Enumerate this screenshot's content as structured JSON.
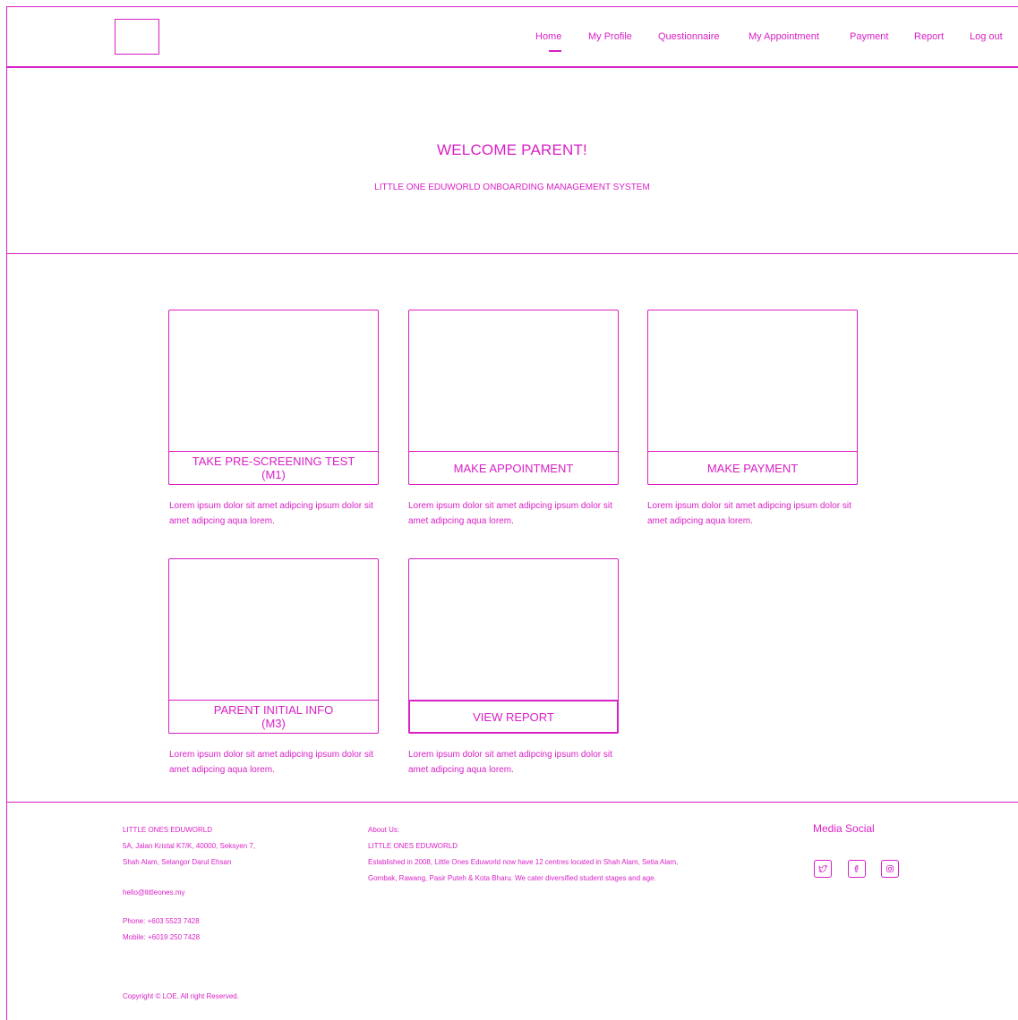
{
  "nav": {
    "items": [
      "Home",
      "My Profile",
      "Questionnaire",
      "My Appointment",
      "Payment",
      "Report",
      "Log out"
    ],
    "active": "Home"
  },
  "hero": {
    "title": "WELCOME PARENT!",
    "subtitle": "LITTLE ONE EDUWORLD ONBOARDING MANAGEMENT SYSTEM"
  },
  "cards": [
    {
      "label": "TAKE PRE-SCREENING TEST\n(M1)",
      "description": "Lorem ipsum dolor sit amet adipcing ipsum dolor sit amet adipcing aqua lorem."
    },
    {
      "label": "MAKE APPOINTMENT",
      "description": "Lorem ipsum dolor sit amet adipcing ipsum dolor sit amet adipcing aqua lorem."
    },
    {
      "label": "MAKE PAYMENT",
      "description": "Lorem ipsum dolor sit amet adipcing ipsum dolor sit amet adipcing aqua lorem."
    },
    {
      "label": "PARENT INITIAL INFO\n(M3)",
      "description": "Lorem ipsum dolor sit amet adipcing ipsum dolor sit amet adipcing aqua lorem."
    },
    {
      "label": "VIEW REPORT",
      "description": "Lorem ipsum dolor sit amet adipcing ipsum dolor sit amet adipcing aqua lorem."
    }
  ],
  "footer": {
    "company": "LITTLE ONES EDUWORLD",
    "address_line1": "5A, Jalan Kristal K7/K, 40000, Seksyen 7,",
    "address_line2": "Shah Alam, Selangor Darul Ehsan",
    "email": "hello@littleones.my",
    "phone": "Phone: +603 5523 7428",
    "mobile": "Mobile: +6019 250 7428",
    "copyright": "Copyright © LOE. All right Reserved.",
    "about_label": "About Us:",
    "about_company": "LITTLE ONES EDUWORLD",
    "about_line1": "Established in 2008, Little Ones Eduworld now have 12 centres located in Shah Alam, Setia Alam,",
    "about_line2": "Gombak, Rawang, Pasir Puteh & Kota Bharu.  We cater diversified student stages and age.",
    "media_title": "Media Social",
    "social_icons": [
      "twitter-icon",
      "facebook-icon",
      "instagram-icon"
    ]
  },
  "colors": {
    "accent": "#d91fc6",
    "background": "#ffffff"
  }
}
